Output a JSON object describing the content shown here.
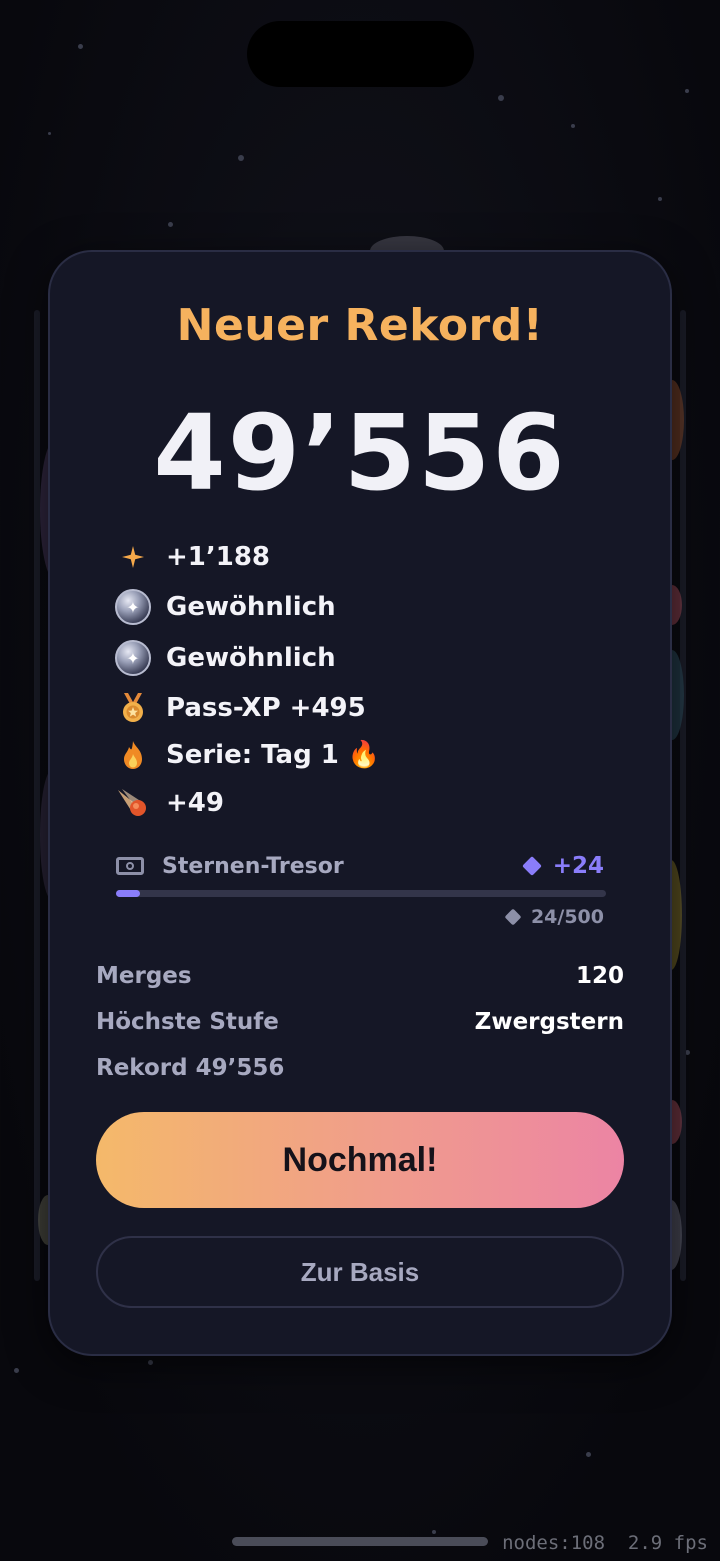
{
  "result": {
    "title": "Neuer Rekord!",
    "score": "49’556"
  },
  "rewards": [
    {
      "icon": "sparkle-icon",
      "text": "+1’188"
    },
    {
      "icon": "common-orb-icon",
      "text": "Gewöhnlich"
    },
    {
      "icon": "common-orb-icon",
      "text": "Gewöhnlich"
    },
    {
      "icon": "medal-icon",
      "text": "Pass-XP +495"
    },
    {
      "icon": "flame-icon",
      "text": "Serie: Tag 1 🔥"
    },
    {
      "icon": "comet-icon",
      "text": "+49"
    }
  ],
  "vault": {
    "icon": "vault-icon",
    "label": "Sternen-Tresor",
    "gain": "+24",
    "count": "24/500",
    "progress": 0.048,
    "accent_color": "#8a7dfa"
  },
  "stats": [
    {
      "label": "Merges",
      "value": "120"
    },
    {
      "label": "Höchste Stufe",
      "value": "Zwergstern"
    },
    {
      "label": "Rekord 49’556",
      "value": ""
    }
  ],
  "buttons": {
    "primary": "Nochmal!",
    "secondary": "Zur Basis"
  },
  "debug": {
    "nodes": "nodes:108",
    "fps": "2.9 fps"
  },
  "colors": {
    "title": "#f6b25e",
    "primary_gradient_start": "#f4b96a",
    "primary_gradient_end": "#ec84a4",
    "card_bg": "#151726"
  }
}
